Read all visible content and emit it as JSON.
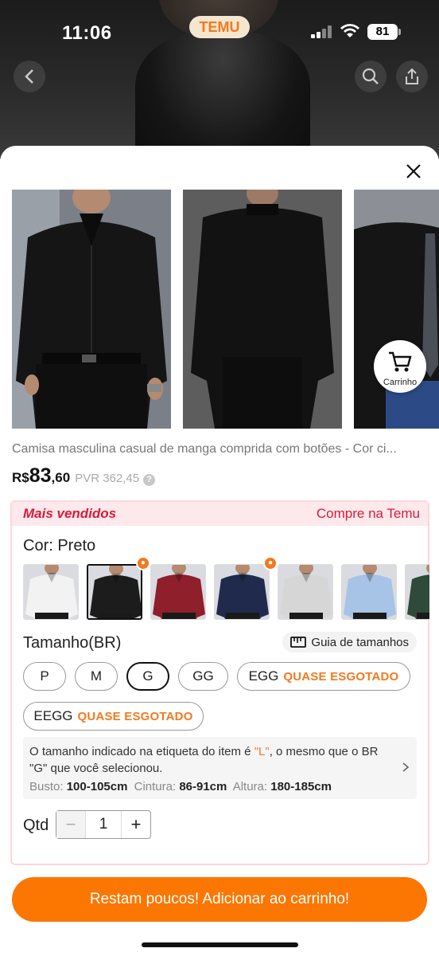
{
  "status_bar": {
    "time": "11:06",
    "app_badge": "TEMU",
    "battery": "81"
  },
  "colors": {
    "accent": "#fb7701",
    "best_seller_red": "#d81b3a",
    "low_stock": "#f37a1f"
  },
  "cart_bubble": {
    "label": "Carrinho"
  },
  "product": {
    "title": "Camisa masculina casual de manga comprida com botões - Cor ci...",
    "price_currency": "R$",
    "price_int": "83",
    "price_dec": ",60",
    "pvr": "PVR 362,45"
  },
  "panel": {
    "best_seller": "Mais vendidos",
    "shop_link": "Compre na Temu",
    "color_label": "Cor: Preto",
    "swatches": [
      {
        "name": "Branco",
        "color": "#f2f2f2"
      },
      {
        "name": "Preto",
        "color": "#1c1c1c"
      },
      {
        "name": "Vinho",
        "color": "#8e1f2b"
      },
      {
        "name": "Marinho",
        "color": "#1f2a4d"
      },
      {
        "name": "Cinza",
        "color": "#d6d6d6"
      },
      {
        "name": "Azul",
        "color": "#a7c3e6"
      },
      {
        "name": "Verde",
        "color": "#2e4a3a"
      }
    ],
    "size_label": "Tamanho(BR)",
    "size_guide": "Guia de tamanhos",
    "sizes": [
      {
        "label": "P",
        "note": ""
      },
      {
        "label": "M",
        "note": ""
      },
      {
        "label": "G",
        "note": ""
      },
      {
        "label": "GG",
        "note": ""
      },
      {
        "label": "EGG",
        "note": "QUASE ESGOTADO"
      },
      {
        "label": "EEGG",
        "note": "QUASE ESGOTADO"
      }
    ],
    "size_note": {
      "part1": "O tamanho indicado na etiqueta do item é ",
      "tag_size": "\"L\"",
      "part2": ", o mesmo que o BR",
      "part3": "\"G\" que você selecionou.",
      "busto_k": "Busto:",
      "busto_v": "100-105cm",
      "cintura_k": "Cintura:",
      "cintura_v": "86-91cm",
      "altura_k": "Altura:",
      "altura_v": "180-185cm"
    },
    "qty_label": "Qtd",
    "qty_value": "1",
    "qty_minus": "−",
    "qty_plus": "+"
  },
  "cta": {
    "label": "Restam poucos! Adicionar ao carrinho!"
  }
}
